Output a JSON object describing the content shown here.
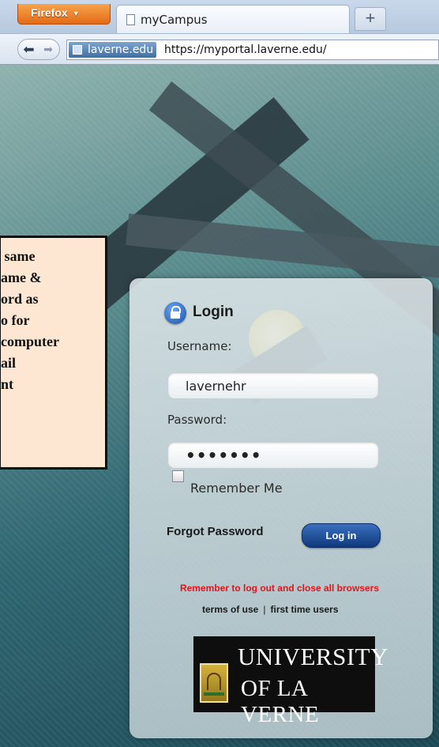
{
  "browser": {
    "menu_button": "Firefox",
    "tab_title": "myCampus",
    "new_tab_symbol": "+",
    "site_identity": "laverne.edu",
    "url": "https://myportal.laverne.edu/"
  },
  "annotation": {
    "text": " same\name &\nord as\no for\ncomputer\nail\nnt"
  },
  "login": {
    "title": "Login",
    "username_label": "Username:",
    "username_value": "lavernehr",
    "password_label": "Password:",
    "password_mask": "•••••••",
    "remember_label": "Remember Me",
    "remember_checked": false,
    "forgot_link": "Forgot Password",
    "login_button": "Log in",
    "reminder": "Remember to log out and close all browsers",
    "terms_link": "terms of use",
    "separator": "|",
    "first_time_link": "first time users"
  },
  "logo": {
    "line1": "UNIVERSITY",
    "line2": "OF LA VERNE"
  },
  "colors": {
    "firefox_orange": "#e56a16",
    "login_button": "#10397c",
    "reminder_red": "#e3141a",
    "callout_bg": "#fde7d3"
  },
  "icons": [
    "page-icon",
    "back-arrow-icon",
    "forward-arrow-icon",
    "site-favicon-icon",
    "lock-icon",
    "university-seal-icon"
  ]
}
